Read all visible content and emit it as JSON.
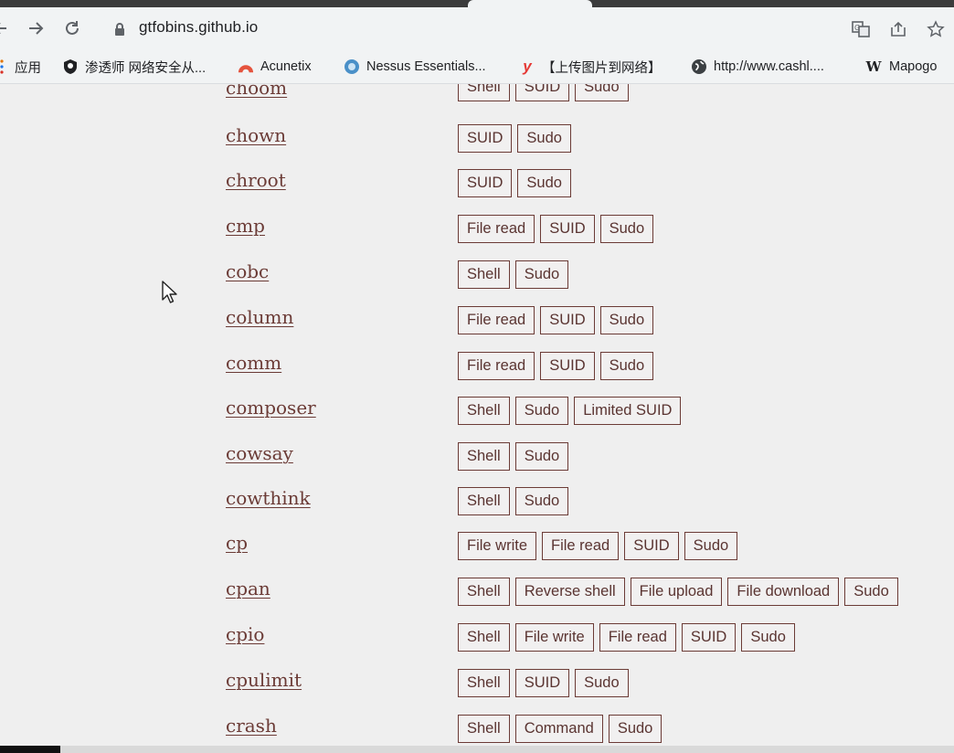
{
  "browser": {
    "url": "gtfobins.github.io",
    "bookmarks": [
      {
        "label": "应用",
        "icon": "apps-grid-icon"
      },
      {
        "label": "渗透师 网络安全从...",
        "icon": "shield-icon"
      },
      {
        "label": "Acunetix",
        "icon": "acunetix-icon"
      },
      {
        "label": "Nessus Essentials...",
        "icon": "nessus-icon"
      },
      {
        "label": "【上传图片到网络】",
        "icon": "y-logo-icon"
      },
      {
        "label": "http://www.cashl....",
        "icon": "globe-icon"
      },
      {
        "label": "Mapogo",
        "icon": "wikipedia-w-icon"
      }
    ],
    "toolbar_icons": [
      "back-arrow-icon",
      "forward-arrow-icon",
      "reload-icon",
      "lock-icon",
      "translate-icon",
      "share-icon",
      "bookmark-star-icon"
    ]
  },
  "binaries": [
    {
      "name": "choom",
      "tags": [
        "Shell",
        "SUID",
        "Sudo"
      ]
    },
    {
      "name": "chown",
      "tags": [
        "SUID",
        "Sudo"
      ]
    },
    {
      "name": "chroot",
      "tags": [
        "SUID",
        "Sudo"
      ]
    },
    {
      "name": "cmp",
      "tags": [
        "File read",
        "SUID",
        "Sudo"
      ]
    },
    {
      "name": "cobc",
      "tags": [
        "Shell",
        "Sudo"
      ]
    },
    {
      "name": "column",
      "tags": [
        "File read",
        "SUID",
        "Sudo"
      ]
    },
    {
      "name": "comm",
      "tags": [
        "File read",
        "SUID",
        "Sudo"
      ]
    },
    {
      "name": "composer",
      "tags": [
        "Shell",
        "Sudo",
        "Limited SUID"
      ]
    },
    {
      "name": "cowsay",
      "tags": [
        "Shell",
        "Sudo"
      ]
    },
    {
      "name": "cowthink",
      "tags": [
        "Shell",
        "Sudo"
      ]
    },
    {
      "name": "cp",
      "tags": [
        "File write",
        "File read",
        "SUID",
        "Sudo"
      ]
    },
    {
      "name": "cpan",
      "tags": [
        "Shell",
        "Reverse shell",
        "File upload",
        "File download",
        "Sudo"
      ]
    },
    {
      "name": "cpio",
      "tags": [
        "Shell",
        "File write",
        "File read",
        "SUID",
        "Sudo"
      ]
    },
    {
      "name": "cpulimit",
      "tags": [
        "Shell",
        "SUID",
        "Sudo"
      ]
    },
    {
      "name": "crash",
      "tags": [
        "Shell",
        "Command",
        "Sudo"
      ]
    }
  ],
  "colors": {
    "link": "#6b3b36",
    "tag_border": "#6b3b36",
    "page_bg": "#efefef"
  }
}
